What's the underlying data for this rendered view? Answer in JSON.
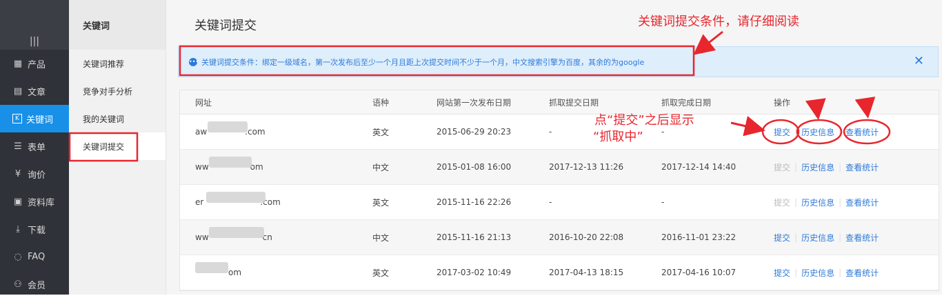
{
  "nav": {
    "items": [
      {
        "label": "产品",
        "icon": "grid-icon"
      },
      {
        "label": "文章",
        "icon": "document-icon"
      },
      {
        "label": "关键词",
        "icon": "keyword-icon"
      },
      {
        "label": "表单",
        "icon": "form-icon"
      },
      {
        "label": "询价",
        "icon": "inquiry-icon"
      },
      {
        "label": "资料库",
        "icon": "library-icon"
      },
      {
        "label": "下载",
        "icon": "download-icon"
      },
      {
        "label": "FAQ",
        "icon": "faq-icon"
      },
      {
        "label": "会员",
        "icon": "member-icon"
      }
    ]
  },
  "sub": {
    "heading": "关键词",
    "items": [
      "关键词推荐",
      "竞争对手分析",
      "我的关键词",
      "关键词提交"
    ]
  },
  "main": {
    "title": "关键词提交",
    "notice": "关键词提交条件：绑定一级域名，第一次发布后至少一个月且距上次提交时间不少于一个月，中文搜索引擎为百度，其余的为google"
  },
  "table": {
    "headers": [
      "网址",
      "语种",
      "网站第一次发布日期",
      "抓取提交日期",
      "抓取完成日期",
      "操作"
    ],
    "rows": [
      {
        "url_a": "aw",
        "url_b": ".com",
        "lang": "英文",
        "first": "2015-06-29 20:23",
        "submit": "-",
        "done": "-",
        "submit_enabled": true
      },
      {
        "url_a": "ww",
        "url_b": "om",
        "lang": "中文",
        "first": "2015-01-08 16:00",
        "submit": "2017-12-13 11:26",
        "done": "2017-12-14 14:40",
        "submit_enabled": false
      },
      {
        "url_a": "er",
        "url_b": ".com",
        "lang": "英文",
        "first": "2015-11-16 22:26",
        "submit": "-",
        "done": "-",
        "submit_enabled": false
      },
      {
        "url_a": "ww",
        "url_b": "cn",
        "lang": "中文",
        "first": "2015-11-16 21:13",
        "submit": "2016-10-20 22:08",
        "done": "2016-11-01 23:22",
        "submit_enabled": true
      },
      {
        "url_a": "",
        "url_b": "om",
        "lang": "英文",
        "first": "2017-03-02 10:49",
        "submit": "2017-04-13 18:15",
        "done": "2017-04-16 10:07",
        "submit_enabled": true
      }
    ],
    "actions": {
      "submit": "提交",
      "history": "历史信息",
      "stats": "查看统计"
    }
  },
  "annotations": {
    "top": "关键词提交条件，请仔细阅读",
    "mid_line1": "点“提交”之后显示",
    "mid_line2": "“抓取中”"
  },
  "colors": {
    "accent": "#1890e8",
    "link": "#2d7ad9",
    "annotation": "#e8262e"
  }
}
